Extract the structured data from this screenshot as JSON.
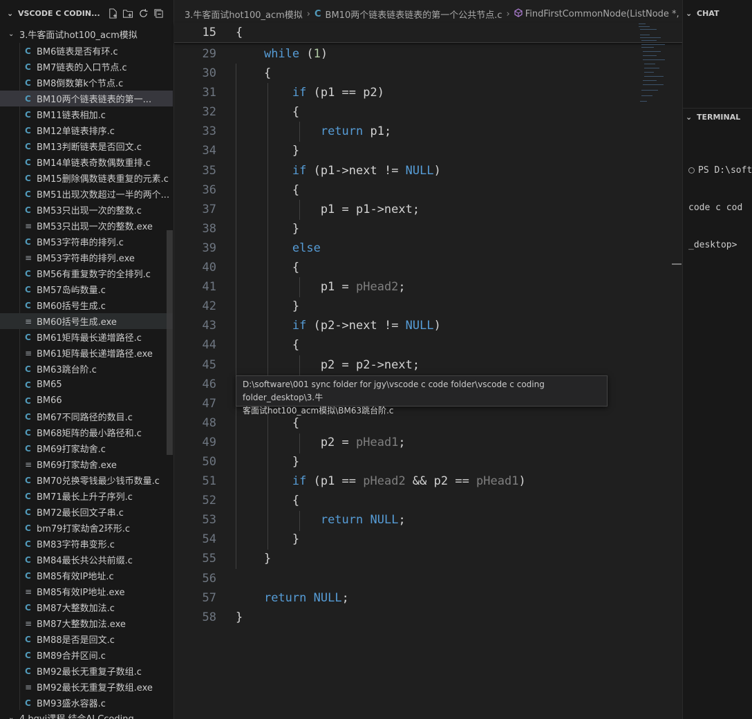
{
  "explorer": {
    "title": "VSCODE C CODIN...",
    "folder": "3.牛客面试hot100_acm模拟",
    "bottom_folder": "4.bgvj课程 结合AI Ccoding",
    "files": [
      {
        "type": "c",
        "name": "BM6链表是否有环.c"
      },
      {
        "type": "c",
        "name": "BM7链表的入口节点.c"
      },
      {
        "type": "c",
        "name": "BM8倒数第k个节点.c"
      },
      {
        "type": "c",
        "name": "BM10两个链表链表的第一..."
      },
      {
        "type": "c",
        "name": "BM11链表相加.c"
      },
      {
        "type": "c",
        "name": "BM12单链表排序.c"
      },
      {
        "type": "c",
        "name": "BM13判断链表是否回文.c"
      },
      {
        "type": "c",
        "name": "BM14单链表奇数偶数重排.c"
      },
      {
        "type": "c",
        "name": "BM15删除偶数链表重复的元素.c"
      },
      {
        "type": "c",
        "name": "BM51出现次数超过一半的两个..."
      },
      {
        "type": "c",
        "name": "BM53只出现一次的整数.c"
      },
      {
        "type": "exe",
        "name": "BM53只出现一次的整数.exe"
      },
      {
        "type": "c",
        "name": "BM53字符串的排列.c"
      },
      {
        "type": "exe",
        "name": "BM53字符串的排列.exe"
      },
      {
        "type": "c",
        "name": "BM56有重复数字的全排列.c"
      },
      {
        "type": "c",
        "name": "BM57岛屿数量.c"
      },
      {
        "type": "c",
        "name": "BM60括号生成.c"
      },
      {
        "type": "exe",
        "name": "BM60括号生成.exe"
      },
      {
        "type": "c",
        "name": "BM61矩阵最长递增路径.c"
      },
      {
        "type": "exe",
        "name": "BM61矩阵最长递增路径.exe"
      },
      {
        "type": "c",
        "name": "BM63跳台阶.c"
      },
      {
        "type": "c",
        "name": "BM65"
      },
      {
        "type": "c",
        "name": "BM66"
      },
      {
        "type": "c",
        "name": "BM67不同路径的数目.c"
      },
      {
        "type": "c",
        "name": "BM68矩阵的最小路径和.c"
      },
      {
        "type": "c",
        "name": "BM69打家劫舍.c"
      },
      {
        "type": "exe",
        "name": "BM69打家劫舍.exe"
      },
      {
        "type": "c",
        "name": "BM70兑换零钱最少钱币数量.c"
      },
      {
        "type": "c",
        "name": "BM71最长上升子序列.c"
      },
      {
        "type": "c",
        "name": "BM72最长回文子串.c"
      },
      {
        "type": "c",
        "name": "bm79打家劫舍2环形.c"
      },
      {
        "type": "c",
        "name": "BM83字符串变形.c"
      },
      {
        "type": "c",
        "name": "BM84最长共公共前缀.c"
      },
      {
        "type": "c",
        "name": "BM85有效IP地址.c"
      },
      {
        "type": "exe",
        "name": "BM85有效IP地址.exe"
      },
      {
        "type": "c",
        "name": "BM87大整数加法.c"
      },
      {
        "type": "exe",
        "name": "BM87大整数加法.exe"
      },
      {
        "type": "c",
        "name": "BM88是否是回文.c"
      },
      {
        "type": "c",
        "name": "BM89合并区间.c"
      },
      {
        "type": "c",
        "name": "BM92最长无重复子数组.c"
      },
      {
        "type": "exe",
        "name": "BM92最长无重复子数组.exe"
      },
      {
        "type": "c",
        "name": "BM93盛水容器.c"
      }
    ]
  },
  "breadcrumb": {
    "folder": "3.牛客面试hot100_acm模拟",
    "file": "BM10两个链表链表链表的第一个公共节点.c",
    "symbol": "FindFirstCommonNode(ListNode *, L"
  },
  "icons": {
    "c_file": "C",
    "exe_file": "≡"
  },
  "tooltip": {
    "line1": "D:\\software\\001 sync folder for jgy\\vscode c code folder\\vscode c coding folder_desktop\\3.牛",
    "line2": "客面试hot100_acm模拟\\BM63跳台阶.c"
  },
  "code": {
    "sticky_num": "15",
    "sticky_text": "{",
    "lines": [
      {
        "num": "29",
        "html": "    <span class=\"c\">while</span> (<span class=\"n\">1</span>)"
      },
      {
        "num": "30",
        "html": "    {"
      },
      {
        "num": "31",
        "html": "        <span class=\"c\">if</span> (p1 == p2)"
      },
      {
        "num": "32",
        "html": "        {"
      },
      {
        "num": "33",
        "html": "            <span class=\"c\">return</span> p1;"
      },
      {
        "num": "34",
        "html": "        }"
      },
      {
        "num": "35",
        "html": "        <span class=\"c\">if</span> (p1-&gt;next != <span class=\"k\">NULL</span>)"
      },
      {
        "num": "36",
        "html": "        {"
      },
      {
        "num": "37",
        "html": "            p1 = p1-&gt;next;"
      },
      {
        "num": "38",
        "html": "        }"
      },
      {
        "num": "39",
        "html": "        <span class=\"c\">else</span>"
      },
      {
        "num": "40",
        "html": "        {"
      },
      {
        "num": "41",
        "html": "            p1 = <span class=\"dim\">pHead2</span>;"
      },
      {
        "num": "42",
        "html": "        }"
      },
      {
        "num": "43",
        "html": "        <span class=\"c\">if</span> (p2-&gt;next != <span class=\"k\">NULL</span>)"
      },
      {
        "num": "44",
        "html": "        {"
      },
      {
        "num": "45",
        "html": "            p2 = p2-&gt;next;"
      },
      {
        "num": "46",
        "html": ""
      },
      {
        "num": "47",
        "html": ""
      },
      {
        "num": "48",
        "html": "        {"
      },
      {
        "num": "49",
        "html": "            p2 = <span class=\"dim\">pHead1</span>;"
      },
      {
        "num": "50",
        "html": "        }"
      },
      {
        "num": "51",
        "html": "        <span class=\"c\">if</span> (p1 == <span class=\"dim\">pHead2</span> &amp;&amp; p2 == <span class=\"dim\">pHead1</span>)"
      },
      {
        "num": "52",
        "html": "        {"
      },
      {
        "num": "53",
        "html": "            <span class=\"c\">return</span> <span class=\"k\">NULL</span>;"
      },
      {
        "num": "54",
        "html": "        }"
      },
      {
        "num": "55",
        "html": "    }"
      },
      {
        "num": "56",
        "html": ""
      },
      {
        "num": "57",
        "html": "    <span class=\"c\">return</span> <span class=\"k\">NULL</span>;"
      },
      {
        "num": "58",
        "html": "}"
      }
    ]
  },
  "right_panel": {
    "chat_title": "CHAT",
    "terminal_title": "TERMINAL",
    "terminal_lines": [
      "PS D:\\soft",
      "code c cod",
      "_desktop>"
    ]
  }
}
